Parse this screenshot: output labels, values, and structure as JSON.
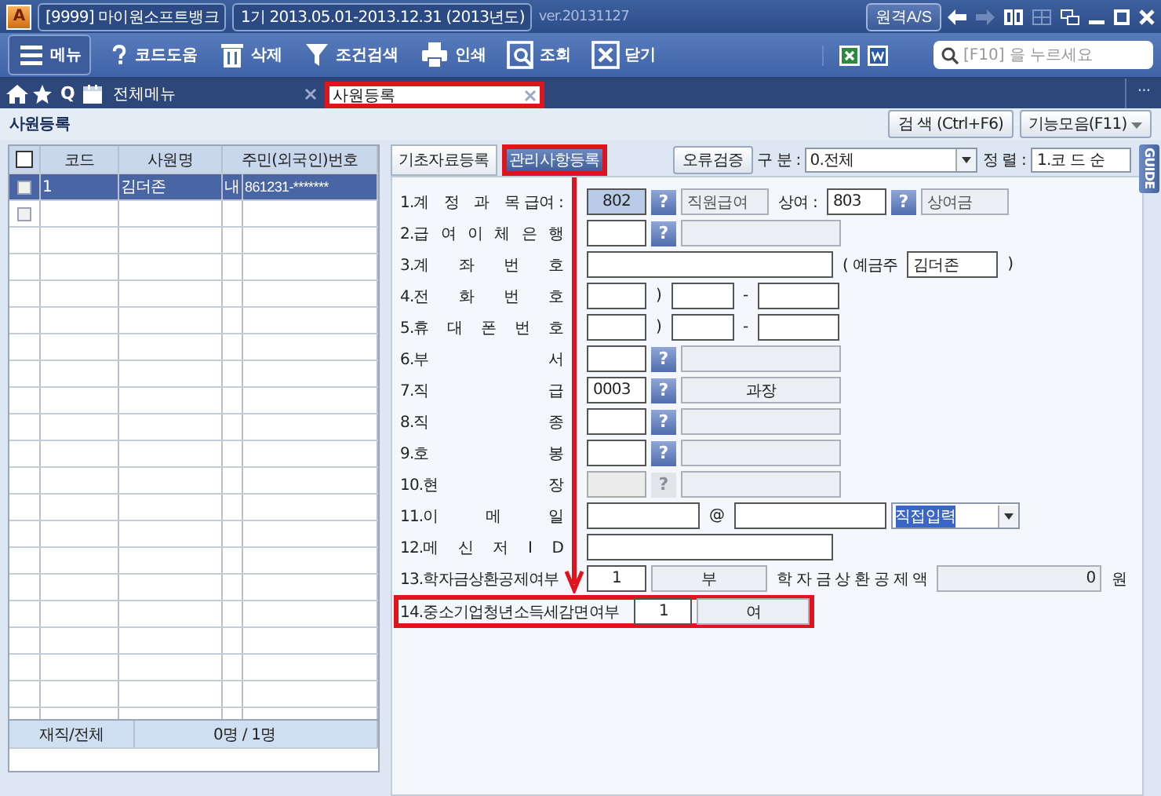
{
  "title_bar": {
    "app_icon": "A",
    "company": "[9999] 마이원소프트뱅크",
    "period": "1기 2013.05.01-2013.12.31 (2013년도)",
    "version": "ver.20131127",
    "remote_button": "원격A/S"
  },
  "toolbar": {
    "buttons": [
      {
        "kind": "menu",
        "label": "메뉴"
      },
      {
        "kind": "help",
        "label": "코드도움"
      },
      {
        "kind": "delete",
        "label": "삭제"
      },
      {
        "kind": "filter",
        "label": "조건검색"
      },
      {
        "kind": "print",
        "label": "인쇄"
      },
      {
        "kind": "search",
        "label": "조회"
      },
      {
        "kind": "close",
        "label": "닫기"
      }
    ],
    "search": {
      "placeholder": "[F10] 을 누르세요"
    }
  },
  "tab_bar": {
    "quick_search": "Q",
    "tabs": [
      {
        "label": "전체메뉴",
        "selected": false,
        "highlighted": false
      },
      {
        "label": "사원등록",
        "selected": true,
        "highlighted": true
      }
    ],
    "more": "..."
  },
  "page": {
    "title": "사원등록",
    "buttons": [
      {
        "kind": "button",
        "label": "검 색 (Ctrl+F6)"
      },
      {
        "kind": "menu",
        "label": "기능모음(F11)"
      }
    ]
  },
  "employee_grid": {
    "columns": [
      "코드",
      "사원명",
      "주민(외국인)번호"
    ],
    "header_checked": false,
    "rows": [
      {
        "kind": "record",
        "selected": true,
        "checked": false,
        "code": "1",
        "name": "김더존",
        "type": "내",
        "id_number": "861231-*******"
      },
      {
        "kind": "new",
        "selected": false,
        "checked": false
      }
    ],
    "footer": {
      "label": "재직/전체",
      "value": "0명 / 1명"
    }
  },
  "detail": {
    "tabs": [
      {
        "label": "기초자료등록",
        "selected": false,
        "highlighted": false
      },
      {
        "label": "관리사항등록",
        "selected": true,
        "highlighted": true
      }
    ],
    "validate_button": "오류검증",
    "filter": {
      "label": "구 분 :",
      "value": "0.전체"
    },
    "sort": {
      "label": "정 렬 :",
      "value": "1.코 드 순"
    },
    "guide": "GUIDE",
    "rows": [
      {
        "label": "1.계 정 과 목",
        "sublabel": "급여 :",
        "highlighted": false,
        "fields": [
          {
            "kind": "code",
            "value": "802",
            "focused": true
          },
          {
            "kind": "help",
            "value": "?"
          },
          {
            "kind": "name-short",
            "value": "직원급여"
          },
          {
            "kind": "text",
            "value": "상여 :"
          },
          {
            "kind": "code",
            "value": "803",
            "focused": false
          },
          {
            "kind": "help",
            "value": "?"
          },
          {
            "kind": "name-short",
            "value": "상여금"
          }
        ]
      },
      {
        "label": "2.급 여 이 체 은 행",
        "highlighted": false,
        "fields": [
          {
            "kind": "code"
          },
          {
            "kind": "help",
            "value": "?"
          },
          {
            "kind": "name"
          }
        ]
      },
      {
        "label": "3.계 좌 번 호",
        "highlighted": false,
        "fields": [
          {
            "kind": "wide"
          },
          {
            "kind": "text",
            "value": "( 예금주"
          },
          {
            "kind": "owner",
            "value": "김더존"
          },
          {
            "kind": "text",
            "value": ")"
          }
        ]
      },
      {
        "label": "4.전 화 번 호",
        "highlighted": false,
        "fields": [
          {
            "kind": "area"
          },
          {
            "kind": "text",
            "value": ")"
          },
          {
            "kind": "phone"
          },
          {
            "kind": "text",
            "value": "-"
          },
          {
            "kind": "phone-end"
          }
        ]
      },
      {
        "label": "5.휴 대 폰 번 호",
        "highlighted": false,
        "fields": [
          {
            "kind": "area"
          },
          {
            "kind": "text",
            "value": ")"
          },
          {
            "kind": "phone"
          },
          {
            "kind": "text",
            "value": "-"
          },
          {
            "kind": "phone-end"
          }
        ]
      },
      {
        "label": "6.부 서",
        "highlighted": false,
        "fields": [
          {
            "kind": "code"
          },
          {
            "kind": "help",
            "value": "?"
          },
          {
            "kind": "name"
          }
        ]
      },
      {
        "label": "7.직 급",
        "highlighted": false,
        "fields": [
          {
            "kind": "code",
            "value": "0003"
          },
          {
            "kind": "help",
            "value": "?"
          },
          {
            "kind": "name",
            "value": "과장",
            "centered": true
          }
        ]
      },
      {
        "label": "8.직 종",
        "highlighted": false,
        "fields": [
          {
            "kind": "code"
          },
          {
            "kind": "help",
            "value": "?"
          },
          {
            "kind": "name"
          }
        ]
      },
      {
        "label": "9.호 봉",
        "highlighted": false,
        "fields": [
          {
            "kind": "code"
          },
          {
            "kind": "help",
            "value": "?"
          },
          {
            "kind": "name"
          }
        ]
      },
      {
        "label": "10.현 장",
        "highlighted": false,
        "fields": [
          {
            "kind": "code",
            "disabled": true
          },
          {
            "kind": "help",
            "value": "?",
            "disabled": true
          },
          {
            "kind": "name"
          }
        ]
      },
      {
        "label": "11.이 메 일",
        "highlighted": false,
        "fields": [
          {
            "kind": "email-id"
          },
          {
            "kind": "text",
            "value": "@"
          },
          {
            "kind": "email-domain"
          },
          {
            "kind": "select",
            "value": "직접입력",
            "text_selected": true
          }
        ]
      },
      {
        "label": "12.메 신 저 I D",
        "highlighted": false,
        "fields": [
          {
            "kind": "wide"
          }
        ]
      },
      {
        "label": "13.학자금상환공제여부",
        "highlighted": false,
        "fields": [
          {
            "kind": "flag",
            "value": "1"
          },
          {
            "kind": "flag-name",
            "value": "부"
          },
          {
            "kind": "text",
            "value": "학 자 금 상 환 공 제 액"
          },
          {
            "kind": "amount",
            "value": "0"
          },
          {
            "kind": "text",
            "value": "원"
          }
        ]
      },
      {
        "label": "14.중소기업청년소득세감면여부",
        "highlighted": true,
        "fields": [
          {
            "kind": "flag",
            "value": "1"
          },
          {
            "kind": "flag-name",
            "value": "여"
          }
        ]
      }
    ]
  }
}
